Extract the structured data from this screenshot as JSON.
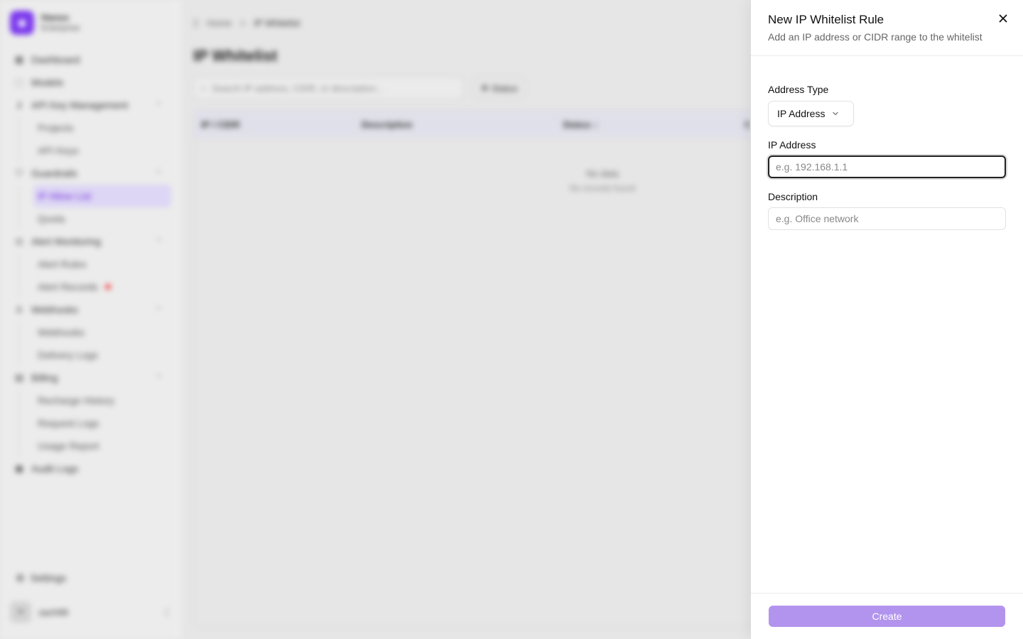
{
  "sidebar": {
    "brand_name": "Hanzo",
    "brand_sub": "Enterprise",
    "items": [
      {
        "label": "Dashboard"
      },
      {
        "label": "Models"
      },
      {
        "label": "API Key Management"
      },
      {
        "label": "Projects"
      },
      {
        "label": "API Keys"
      },
      {
        "label": "Guardrails"
      },
      {
        "label": "IP Allow List"
      },
      {
        "label": "Quota"
      },
      {
        "label": "Alert Monitoring"
      },
      {
        "label": "Alert Rules"
      },
      {
        "label": "Alert Records"
      },
      {
        "label": "Webhooks"
      },
      {
        "label": "Webhooks"
      },
      {
        "label": "Delivery Logs"
      },
      {
        "label": "Billing"
      },
      {
        "label": "Recharge History"
      },
      {
        "label": "Request Logs"
      },
      {
        "label": "Usage Report"
      },
      {
        "label": "Audit Logs"
      }
    ],
    "settings_label": "Settings",
    "user": {
      "avatar": "H",
      "name": "zach99"
    }
  },
  "main": {
    "breadcrumb": {
      "home": "Home",
      "separator": ">",
      "current": "IP Whitelist"
    },
    "title": "IP Whitelist",
    "search_placeholder": "Search IP address, CIDR, or description...",
    "status_filter": "Status",
    "table": {
      "columns": [
        "IP / CIDR",
        "Description",
        "Status ↕",
        "C"
      ],
      "empty_title": "No data",
      "empty_sub": "No records found"
    }
  },
  "drawer": {
    "title": "New IP Whitelist Rule",
    "description": "Add an IP address or CIDR range to the whitelist",
    "address_type_label": "Address Type",
    "address_type_value": "IP Address",
    "ip_label": "IP Address",
    "ip_placeholder": "e.g. 192.168.1.1",
    "description_label": "Description",
    "description_placeholder": "e.g. Office network",
    "create_label": "Create"
  },
  "colors": {
    "accent": "#7c3aed",
    "create_button": "#b294ee"
  },
  "icons": {
    "close": "close-icon",
    "select_chevron": "chevron-down-icon"
  }
}
